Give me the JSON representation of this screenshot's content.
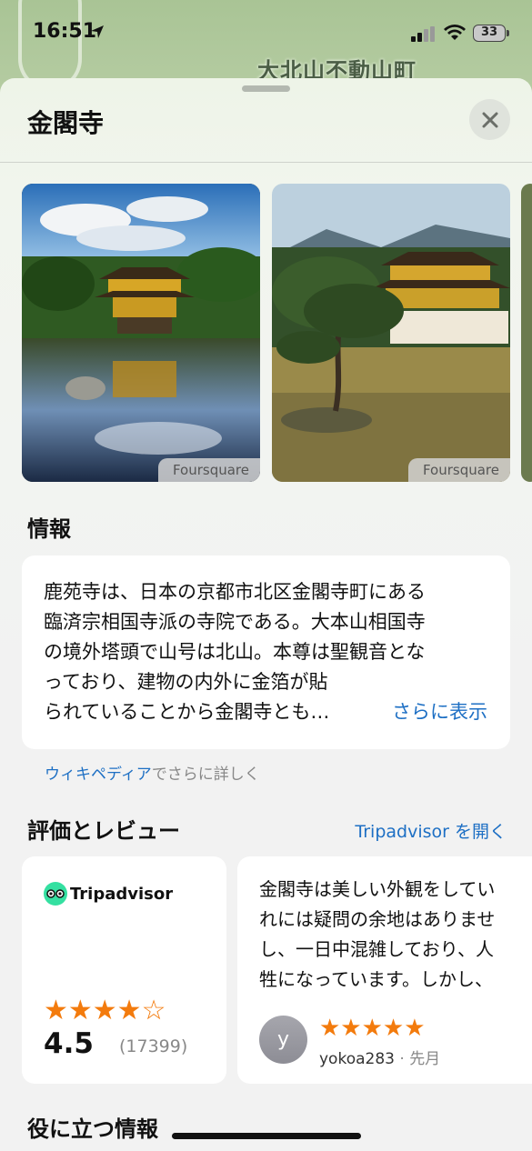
{
  "status_bar": {
    "time": "16:51",
    "battery": "33"
  },
  "map": {
    "label": "大北山不動山町"
  },
  "sheet": {
    "title": "金閣寺"
  },
  "photos": [
    {
      "credit": "Foursquare"
    },
    {
      "credit": "Foursquare"
    }
  ],
  "info": {
    "heading": "情報",
    "lines": [
      "鹿苑寺は、日本の京都市北区金閣寺町にある",
      "臨済宗相国寺派の寺院である。大本山相国寺",
      "の境外塔頭で山号は北山。本尊は聖観音とな",
      "っており、建物の内外に金箔が貼",
      "られていることから金閣寺とも…"
    ],
    "more_label": "さらに表示",
    "wiki_link": "ウィキペディア",
    "wiki_suffix": "でさらに詳しく"
  },
  "reviews": {
    "heading": "評価とレビュー",
    "open_label": "Tripadvisor を開く",
    "provider": "Tripadvisor",
    "rating_stars": "★★★★☆",
    "score": "4.5",
    "count": "(17399)",
    "review": {
      "lines": [
        "金閣寺は美しい外観をしてい",
        "れには疑問の余地はありませ",
        "し、一日中混雑しており、人",
        "牲になっています。しかし、"
      ],
      "avatar_initial": "y",
      "stars": "★★★★★",
      "user": "yokoa283",
      "when": "先月"
    }
  },
  "useful": {
    "heading": "役に立つ情報"
  }
}
